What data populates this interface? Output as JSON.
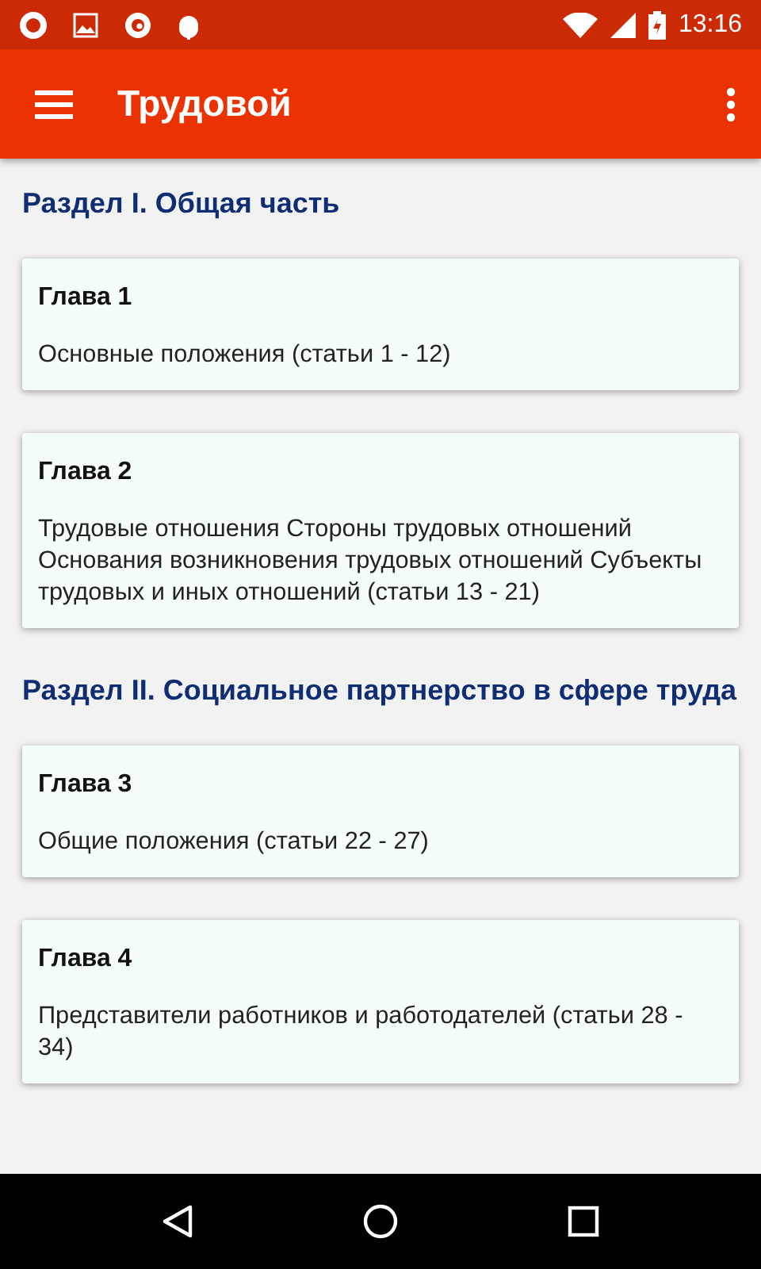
{
  "status_bar": {
    "time": "13:16"
  },
  "app_bar": {
    "title": "Трудовой"
  },
  "sections": [
    {
      "title": "Раздел I. Общая часть",
      "chapters": [
        {
          "title": "Глава 1",
          "text": "Основные положения (статьи 1 - 12)"
        },
        {
          "title": "Глава 2",
          "text": "Трудовые отношения Стороны трудовых отношений Основания возникновения трудовых отношений Субъекты трудовых и иных отношений (статьи 13 - 21)"
        }
      ]
    },
    {
      "title": "Раздел II. Социальное партнерство в сфере труда",
      "chapters": [
        {
          "title": "Глава 3",
          "text": "Общие положения (статьи 22 - 27)"
        },
        {
          "title": "Глава 4",
          "text": "Представители работников и работодателей (статьи 28 - 34)"
        }
      ]
    }
  ]
}
